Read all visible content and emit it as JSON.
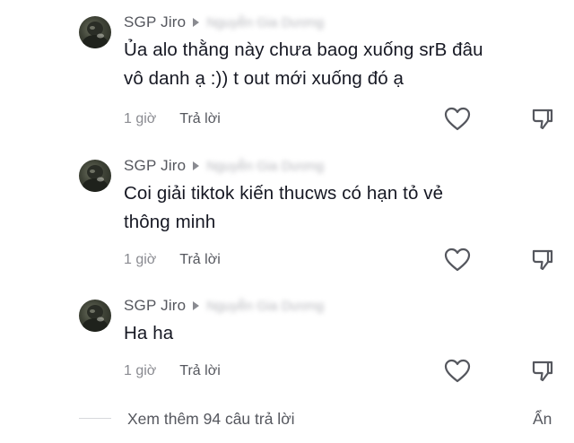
{
  "comments": [
    {
      "username": "SGP Jiro",
      "reply_to": "Nguyễn Gia Dương",
      "text": "Ủa alo thằng này chưa baog xuống srB đâu\nvô danh ạ :)) t out mới xuống đó ạ",
      "time": "1 giờ",
      "reply_label": "Trả lời"
    },
    {
      "username": "SGP Jiro",
      "reply_to": "Nguyễn Gia Dương",
      "text": "Coi giải tiktok kiến thucws có hạn tỏ vẻ\nthông minh",
      "time": "1 giờ",
      "reply_label": "Trả lời"
    },
    {
      "username": "SGP Jiro",
      "reply_to": "Nguyễn Gia Dương",
      "text": "Ha ha",
      "time": "1 giờ",
      "reply_label": "Trả lời"
    }
  ],
  "more_replies_label": "Xem thêm 94 câu trả lời",
  "hide_label": "Ẩn",
  "icons": {
    "avatar": "avatar-photo",
    "reply_indicator": "caret-right-icon",
    "like": "heart-outline-icon",
    "dislike": "thumbs-down-outline-icon"
  },
  "colors": {
    "text_primary": "#161823",
    "text_secondary": "#55575e",
    "text_muted": "#8a8b91",
    "background": "#ffffff"
  }
}
